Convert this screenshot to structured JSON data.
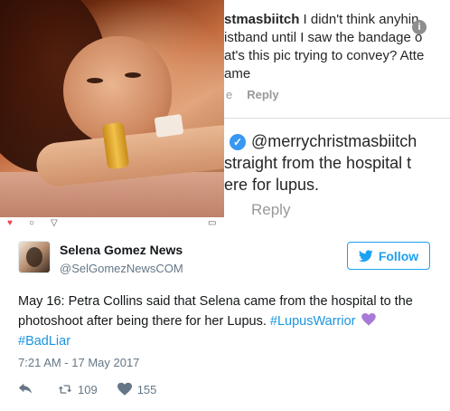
{
  "embed": {
    "comment1": {
      "username": "stmasbiitch",
      "line1": " I didn't think any",
      "line1_tail": "hin",
      "line2": "istband until I saw the bandage o",
      "line3": "at's this pic trying to convey? Atte",
      "line4": "ame",
      "meta_prefix": "e",
      "reply": "Reply"
    },
    "comment2": {
      "mention": "@merrychristmasbiitch",
      "line2": "straight from the hospital t",
      "line3": "ere for lupus.",
      "reply": "Reply"
    }
  },
  "tweet": {
    "name": "Selena Gomez News",
    "handle": "@SelGomezNewsCOM",
    "follow_label": "Follow",
    "text_main": "May 16: Petra Collins said that Selena came from the hospital to the photoshoot after being there for her Lupus. ",
    "hashtag1": "#LupusWarrior",
    "hashtag2": "#BadLiar",
    "emoji": "purple-heart",
    "timestamp": "7:21 AM - 17 May 2017",
    "retweets": "109",
    "likes": "155"
  },
  "colors": {
    "twitter_blue": "#1da1f2",
    "hashtag_blue": "#1b95e0",
    "muted": "#657786",
    "instagram_blue": "#3897f0",
    "purple_heart": "#a77ad6"
  },
  "icons": [
    "info-icon",
    "verified-badge-icon",
    "twitter-bird-icon",
    "reply-icon",
    "retweet-icon",
    "like-icon",
    "purple-heart-emoji"
  ]
}
